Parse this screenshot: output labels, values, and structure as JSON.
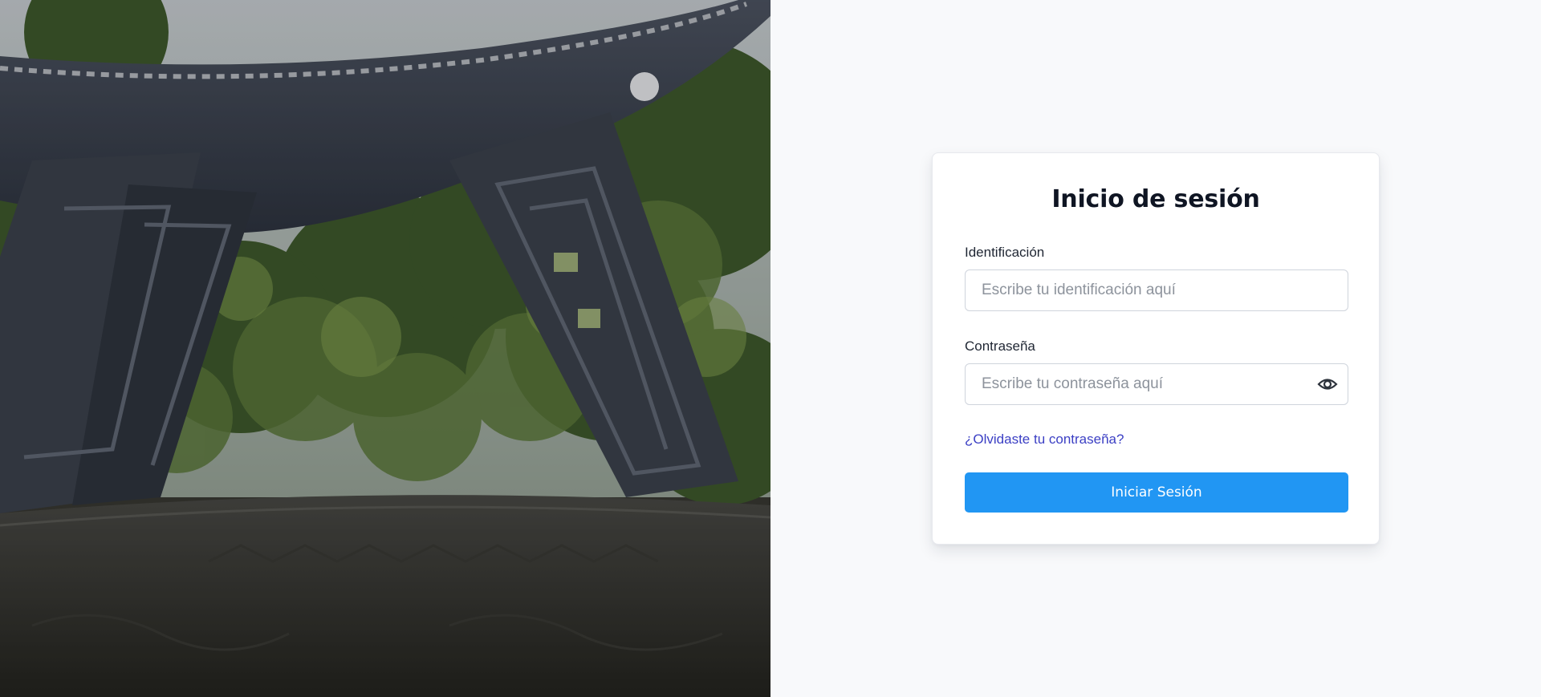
{
  "hero": {
    "image_subject": "photo-of-sculpture-in-park"
  },
  "login": {
    "title": "Inicio de sesión",
    "identification": {
      "label": "Identificación",
      "placeholder": "Escribe tu identificación aquí",
      "value": ""
    },
    "password": {
      "label": "Contraseña",
      "placeholder": "Escribe tu contraseña aquí",
      "value": "",
      "toggle_icon": "eye-icon"
    },
    "forgot_link": "¿Olvidaste tu contraseña?",
    "submit_label": "Iniciar Sesión"
  },
  "colors": {
    "accent": "#2196f3",
    "link": "#3b3fc4",
    "title": "#0f1523",
    "background": "#f8f9fb"
  }
}
